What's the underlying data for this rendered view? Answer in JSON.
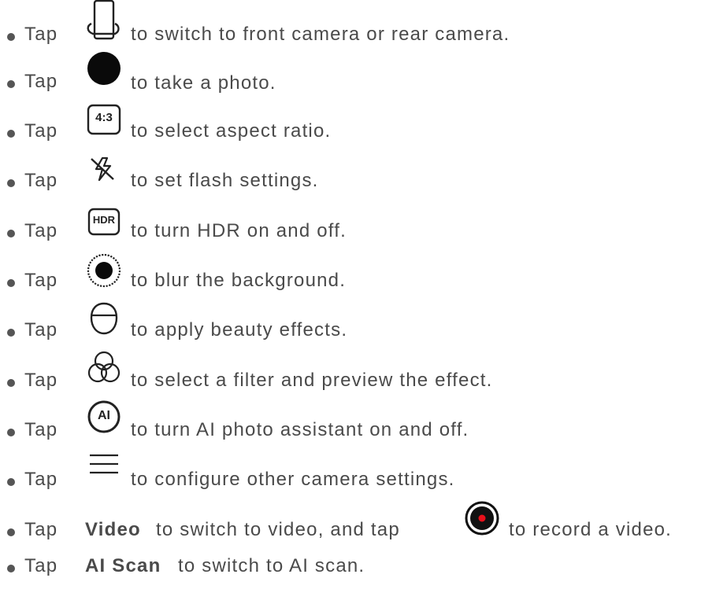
{
  "items": [
    {
      "tap": "Tap",
      "icon": "switch-camera-icon",
      "text": "to switch to front camera or rear camera."
    },
    {
      "tap": "Tap",
      "icon": "shutter-icon",
      "text": "to take a photo."
    },
    {
      "tap": "Tap",
      "icon": "aspect-ratio-icon",
      "icon_text": "4:3",
      "text": "to select aspect ratio."
    },
    {
      "tap": "Tap",
      "icon": "flash-off-icon",
      "text": "to set flash settings."
    },
    {
      "tap": "Tap",
      "icon": "hdr-icon",
      "icon_text": "HDR",
      "text": "to turn HDR on and off."
    },
    {
      "tap": "Tap",
      "icon": "bokeh-icon",
      "text": "to blur the background."
    },
    {
      "tap": "Tap",
      "icon": "beauty-face-icon",
      "text": "to apply beauty effects."
    },
    {
      "tap": "Tap",
      "icon": "filter-circles-icon",
      "text": "to select a filter and preview the effect."
    },
    {
      "tap": "Tap",
      "icon": "ai-assistant-icon",
      "icon_text": "AI",
      "text": "to turn AI photo assistant on and off."
    },
    {
      "tap": "Tap",
      "icon": "menu-icon",
      "text": "to configure other camera settings."
    },
    {
      "tap": "Tap",
      "bold": "Video",
      "mid": "to switch to video, and tap",
      "icon": "record-video-icon",
      "text": "to record a video."
    },
    {
      "tap": "Tap",
      "bold": "AI Scan",
      "text": "to switch to AI scan."
    }
  ],
  "colors": {
    "text": "#4a4a4a",
    "icon": "#222222",
    "record": "#e8101a"
  }
}
